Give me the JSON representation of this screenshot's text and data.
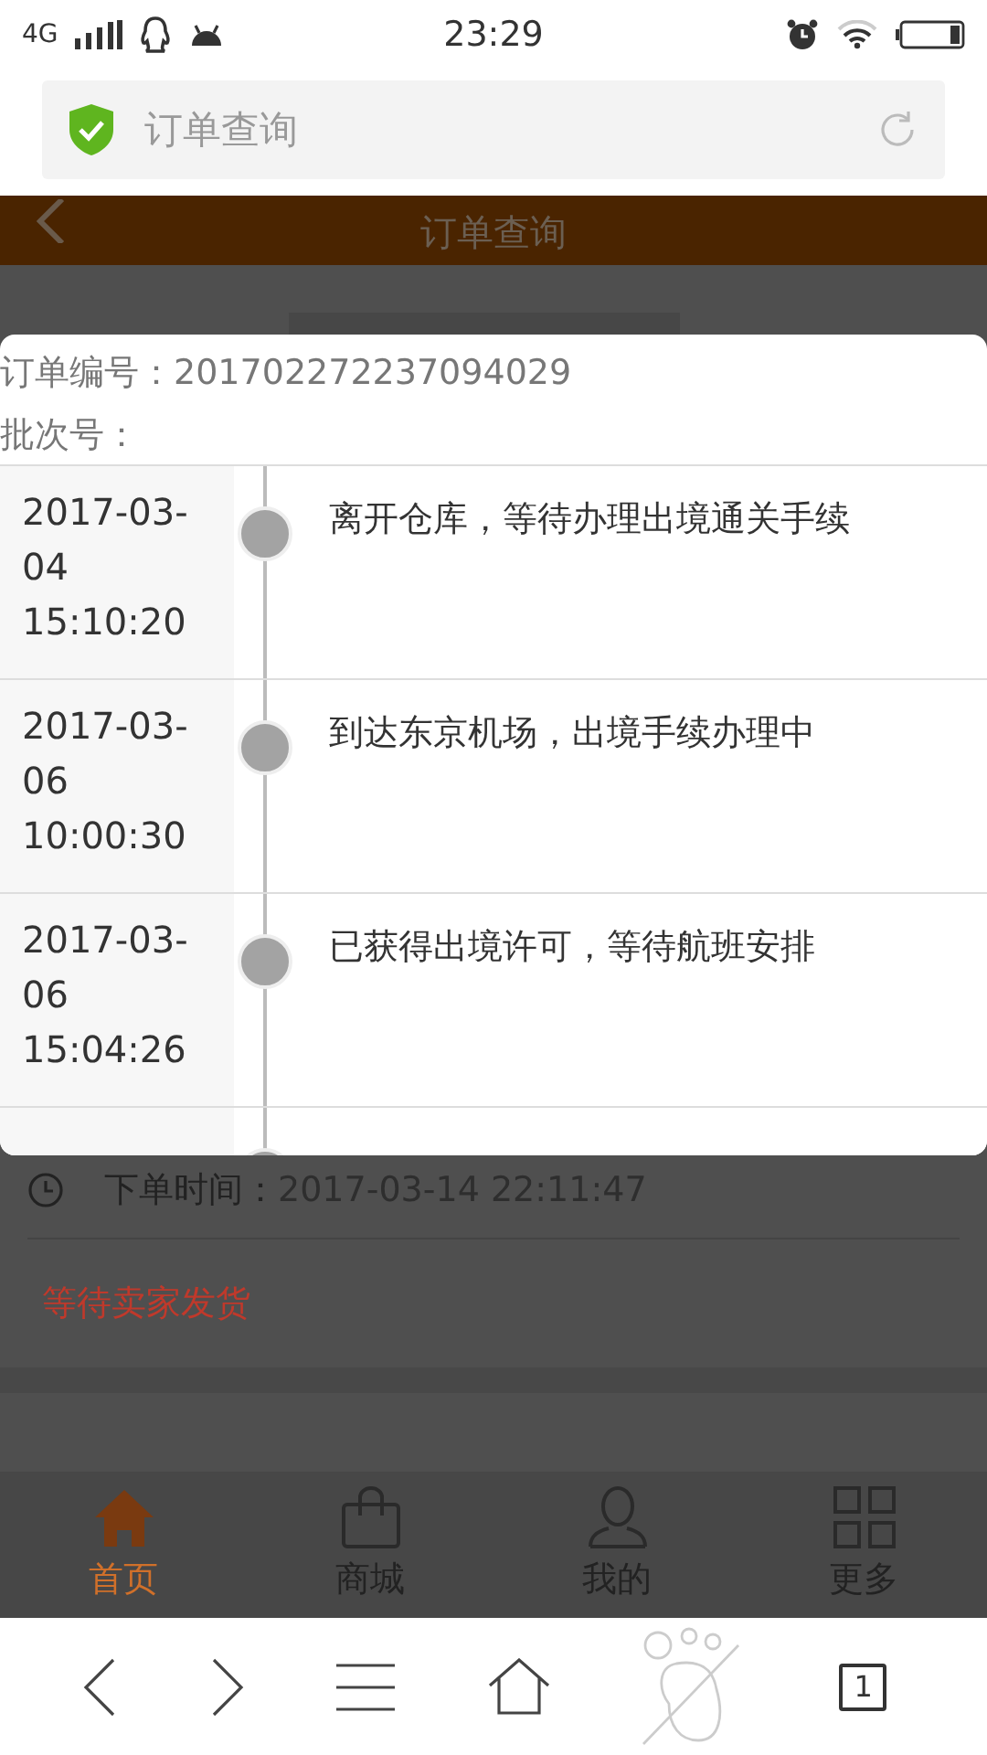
{
  "status_bar": {
    "network": "4G",
    "time": "23:29"
  },
  "address_bar": {
    "title": "订单查询"
  },
  "page": {
    "header_title": "订单查询",
    "order_time_label": "下单时间：",
    "order_time": "2017-03-14 22:11:47",
    "order_status": "等待卖家发货"
  },
  "tracking_modal": {
    "order_number": "订单编号：201702272237094029",
    "batch_number": "批次号：",
    "events": [
      {
        "time": "2017-03-\n04\n15:10:20",
        "text": "离开仓库，等待办理出境通关手续"
      },
      {
        "time": "2017-03-\n06\n10:00:30",
        "text": "到达东京机场，出境手续办理中"
      },
      {
        "time": "2017-03-\n06\n15:04:26",
        "text": "已获得出境许可，等待航班安排"
      }
    ]
  },
  "bottom_nav": [
    {
      "label": "首页",
      "selected": true
    },
    {
      "label": "商城",
      "selected": false
    },
    {
      "label": "我的",
      "selected": false
    },
    {
      "label": "更多",
      "selected": false
    }
  ],
  "browser_toolbar": {
    "tab_count": "1"
  }
}
